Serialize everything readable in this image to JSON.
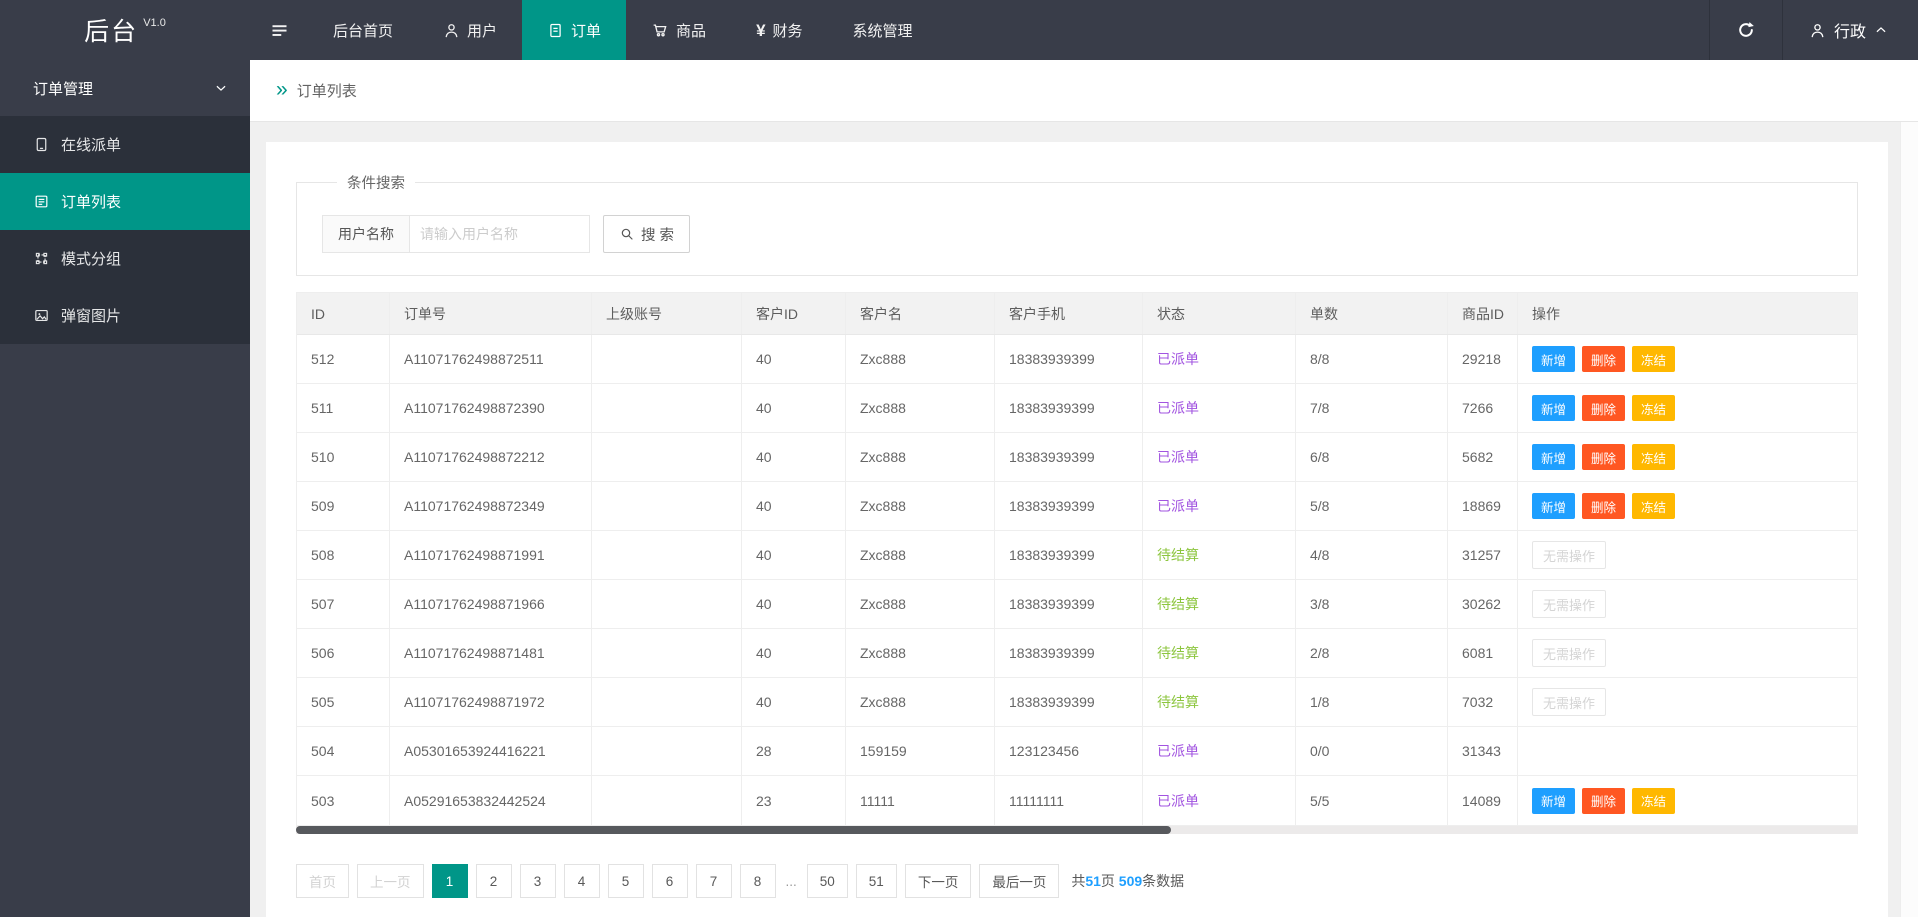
{
  "navbar": {
    "logo": {
      "title": "后台",
      "version": "V1.0"
    },
    "items": [
      {
        "label": "后台首页",
        "icon": null,
        "active": false
      },
      {
        "label": "用户",
        "icon": "user",
        "active": false
      },
      {
        "label": "订单",
        "icon": "document",
        "active": true
      },
      {
        "label": "商品",
        "icon": "cart",
        "active": false
      },
      {
        "label": "财务",
        "icon": "yen",
        "active": false
      },
      {
        "label": "系统管理",
        "icon": null,
        "active": false
      }
    ],
    "user": {
      "name": "行政"
    }
  },
  "sidebar": {
    "group": {
      "label": "订单管理"
    },
    "items": [
      {
        "label": "在线派单",
        "icon": "tablet",
        "active": false
      },
      {
        "label": "订单列表",
        "icon": "list",
        "active": true
      },
      {
        "label": "模式分组",
        "icon": "group",
        "active": false
      },
      {
        "label": "弹窗图片",
        "icon": "image",
        "active": false
      }
    ]
  },
  "breadcrumb": {
    "label": "订单列表"
  },
  "search": {
    "legend": "条件搜索",
    "field_label": "用户名称",
    "placeholder": "请输入用户名称",
    "button_label": "搜 索"
  },
  "table": {
    "columns": [
      "ID",
      "订单号",
      "上级账号",
      "客户ID",
      "客户名",
      "客户手机",
      "状态",
      "单数",
      "商品ID",
      "操作"
    ],
    "action_buttons": {
      "add": "新增",
      "delete": "删除",
      "freeze": "冻结",
      "none": "无需操作"
    },
    "rows": [
      {
        "id": "512",
        "order_no": "A11071762498872511",
        "parent": "",
        "customer_id": "40",
        "customer_name": "Zxc888",
        "phone": "18383939399",
        "status": "已派单",
        "status_type": "dispatched",
        "count": "8/8",
        "product_id": "29218",
        "actions": "full"
      },
      {
        "id": "511",
        "order_no": "A11071762498872390",
        "parent": "",
        "customer_id": "40",
        "customer_name": "Zxc888",
        "phone": "18383939399",
        "status": "已派单",
        "status_type": "dispatched",
        "count": "7/8",
        "product_id": "7266",
        "actions": "full"
      },
      {
        "id": "510",
        "order_no": "A11071762498872212",
        "parent": "",
        "customer_id": "40",
        "customer_name": "Zxc888",
        "phone": "18383939399",
        "status": "已派单",
        "status_type": "dispatched",
        "count": "6/8",
        "product_id": "5682",
        "actions": "full"
      },
      {
        "id": "509",
        "order_no": "A11071762498872349",
        "parent": "",
        "customer_id": "40",
        "customer_name": "Zxc888",
        "phone": "18383939399",
        "status": "已派单",
        "status_type": "dispatched",
        "count": "5/8",
        "product_id": "18869",
        "actions": "full"
      },
      {
        "id": "508",
        "order_no": "A11071762498871991",
        "parent": "",
        "customer_id": "40",
        "customer_name": "Zxc888",
        "phone": "18383939399",
        "status": "待结算",
        "status_type": "pending",
        "count": "4/8",
        "product_id": "31257",
        "actions": "disabled"
      },
      {
        "id": "507",
        "order_no": "A11071762498871966",
        "parent": "",
        "customer_id": "40",
        "customer_name": "Zxc888",
        "phone": "18383939399",
        "status": "待结算",
        "status_type": "pending",
        "count": "3/8",
        "product_id": "30262",
        "actions": "disabled"
      },
      {
        "id": "506",
        "order_no": "A11071762498871481",
        "parent": "",
        "customer_id": "40",
        "customer_name": "Zxc888",
        "phone": "18383939399",
        "status": "待结算",
        "status_type": "pending",
        "count": "2/8",
        "product_id": "6081",
        "actions": "disabled"
      },
      {
        "id": "505",
        "order_no": "A11071762498871972",
        "parent": "",
        "customer_id": "40",
        "customer_name": "Zxc888",
        "phone": "18383939399",
        "status": "待结算",
        "status_type": "pending",
        "count": "1/8",
        "product_id": "7032",
        "actions": "disabled"
      },
      {
        "id": "504",
        "order_no": "A05301653924416221",
        "parent": "",
        "customer_id": "28",
        "customer_name": "159159",
        "phone": "123123456",
        "status": "已派单",
        "status_type": "dispatched",
        "count": "0/0",
        "product_id": "31343",
        "actions": "none"
      },
      {
        "id": "503",
        "order_no": "A05291653832442524",
        "parent": "",
        "customer_id": "23",
        "customer_name": "11111",
        "phone": "11111111",
        "status": "已派单",
        "status_type": "dispatched",
        "count": "5/5",
        "product_id": "14089",
        "actions": "full"
      }
    ]
  },
  "pagination": {
    "buttons": [
      {
        "label": "首页",
        "type": "disabled"
      },
      {
        "label": "上一页",
        "type": "disabled"
      },
      {
        "label": "1",
        "type": "active"
      },
      {
        "label": "2",
        "type": "page"
      },
      {
        "label": "3",
        "type": "page"
      },
      {
        "label": "4",
        "type": "page"
      },
      {
        "label": "5",
        "type": "page"
      },
      {
        "label": "6",
        "type": "page"
      },
      {
        "label": "7",
        "type": "page"
      },
      {
        "label": "8",
        "type": "page"
      },
      {
        "label": "...",
        "type": "ellipsis"
      },
      {
        "label": "50",
        "type": "page"
      },
      {
        "label": "51",
        "type": "page"
      },
      {
        "label": "下一页",
        "type": "page"
      },
      {
        "label": "最后一页",
        "type": "page"
      }
    ],
    "summary": [
      {
        "text": "共",
        "highlight": false
      },
      {
        "text": "51",
        "highlight": true
      },
      {
        "text": "页 ",
        "highlight": false
      },
      {
        "text": "509",
        "highlight": true
      },
      {
        "text": "条数据",
        "highlight": false
      }
    ]
  },
  "colors": {
    "accent": "#009688",
    "navbar_bg": "#393D49",
    "sidebar_child_bg": "#2B303A",
    "status_dispatched": "#A254E0",
    "status_pending": "#8DC63F",
    "btn_add": "#1E9FFF",
    "btn_delete": "#FF5722",
    "btn_freeze": "#FFB800",
    "link_blue": "#1E9FFF"
  }
}
